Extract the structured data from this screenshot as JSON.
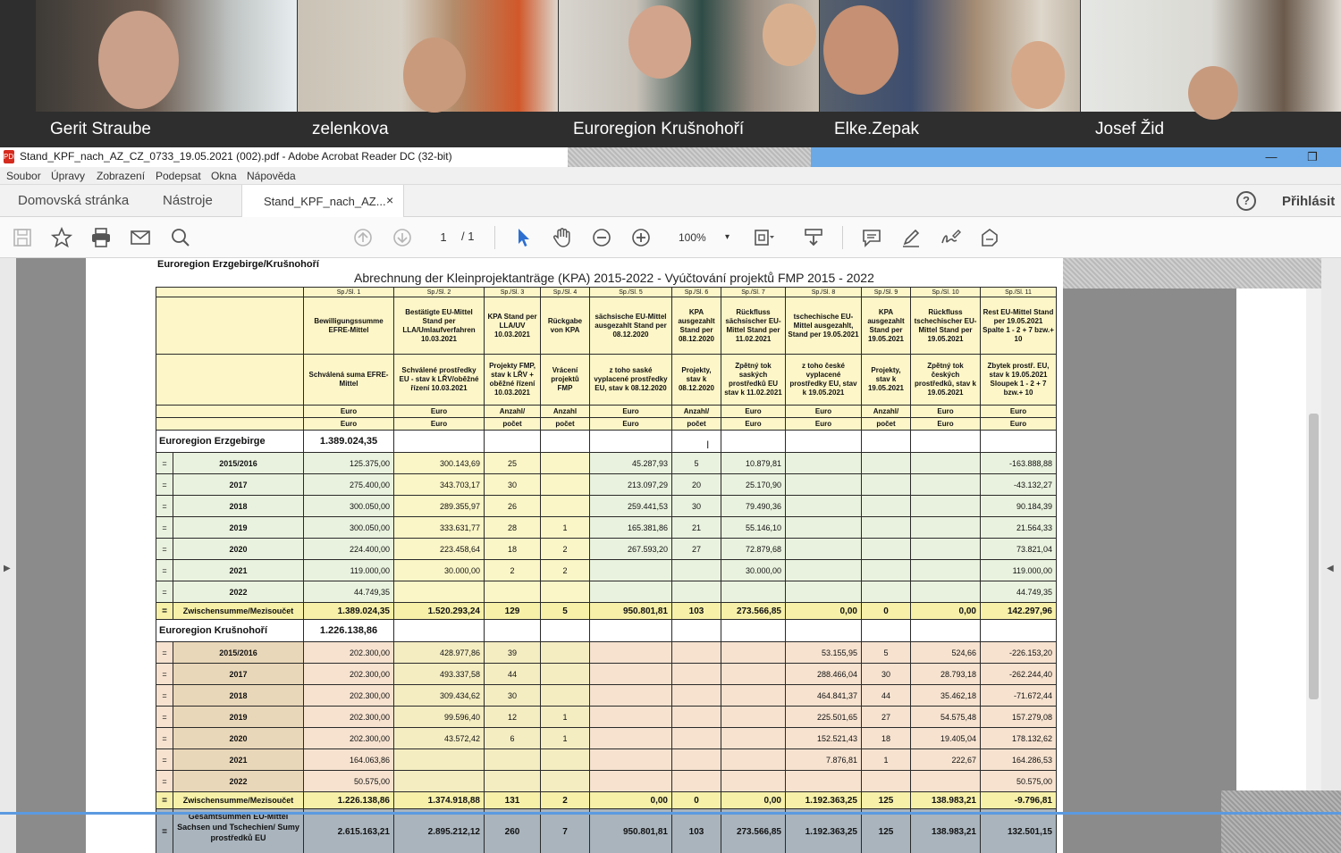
{
  "participants": [
    {
      "name": "Gerit Straube"
    },
    {
      "name": "zelenkova"
    },
    {
      "name": "Euroregion Krušnohoří"
    },
    {
      "name": "Elke.Zepak"
    },
    {
      "name": "Josef Žid"
    }
  ],
  "window": {
    "title": "Stand_KPF_nach_AZ_CZ_0733_19.05.2021 (002).pdf - Adobe Acrobat Reader DC (32-bit)",
    "pdf_icon": "PDF",
    "minimize": "—",
    "restore": "❐"
  },
  "menu": [
    "Soubor",
    "Úpravy",
    "Zobrazení",
    "Podepsat",
    "Okna",
    "Nápověda"
  ],
  "tabs": {
    "home": "Domovská stránka",
    "tools": "Nástroje",
    "document": "Stand_KPF_nach_AZ...",
    "close": "×",
    "help": "?",
    "signin": "Přihlásit"
  },
  "toolbar": {
    "page_current": "1",
    "page_total": "/ 1",
    "zoom": "100%",
    "zoom_caret": "▾",
    "icons": [
      "save-icon",
      "star-icon",
      "print-icon",
      "mail-icon",
      "search-icon",
      "page-up-icon",
      "page-down-icon",
      "select-cursor-icon",
      "hand-icon",
      "zoom-out-icon",
      "zoom-in-icon",
      "fit-page-icon",
      "scroll-icon",
      "comment-icon",
      "highlight-pen-icon",
      "sign-icon",
      "more-tools-icon"
    ]
  },
  "panels": {
    "left_arrow": "▶",
    "right_arrow": "◀"
  },
  "document": {
    "org_title": "Euroregion Erzgebirge/Krušnohoří",
    "title": "Abrechnung der Kleinprojektanträge (KPA) 2015-2022 - Vyúčtování projektů FMP 2015 - 2022",
    "sp_row": [
      "Sp./Sl. 1",
      "Sp./Sl. 2",
      "Sp./Sl. 3",
      "Sp./Sl. 4",
      "Sp./Sl. 5",
      "Sp./Sl. 6",
      "Sp./Sl. 7",
      "Sp./Sl. 8",
      "Sp./Sl. 9",
      "Sp./Sl. 10",
      "Sp./Sl. 11"
    ],
    "header_de": [
      "Bewilligungssumme EFRE-Mittel",
      "Bestätigte EU-Mittel Stand per LLA/Umlaufverfahren 10.03.2021",
      "KPA Stand per LLA/UV 10.03.2021",
      "Rückgabe von KPA",
      "sächsische EU-Mittel ausgezahlt Stand per 08.12.2020",
      "KPA ausgezahlt Stand per 08.12.2020",
      "Rückfluss sächsischer EU-Mittel Stand per 11.02.2021",
      "tschechische EU-Mittel ausgezahlt, Stand per 19.05.2021",
      "KPA ausgezahlt Stand per 19.05.2021",
      "Rückfluss tschechischer EU-Mittel Stand per 19.05.2021",
      "Rest EU-Mittel Stand per 19.05.2021 Spalte 1 - 2 + 7 bzw.+ 10"
    ],
    "header_cz": [
      "Schválená suma EFRE-Mittel",
      "Schválené prostředky EU - stav k LŘV/oběžné řízení 10.03.2021",
      "Projekty FMP, stav k LŘV + oběžné řízení 10.03.2021",
      "Vrácení projektů FMP",
      "z toho saské vyplacené prostředky EU, stav k 08.12.2020",
      "Projekty, stav k 08.12.2020",
      "Zpětný tok saských prostředků EU stav k 11.02.2021",
      "z toho české vyplacené prostředky EU, stav k 19.05.2021",
      "Projekty, stav k 19.05.2021",
      "Zpětný tok českých prostředků, stav k 19.05.2021",
      "Zbytek prostř. EU, stav k 19.05.2021 Sloupek 1 - 2 + 7 bzw.+ 10"
    ],
    "unit_de": [
      "Euro",
      "Euro",
      "Anzahl/",
      "Anzahl",
      "Euro",
      "Anzahl/",
      "Euro",
      "Euro",
      "Anzahl/",
      "Euro",
      "Euro"
    ],
    "unit_cz": [
      "Euro",
      "Euro",
      "počet",
      "počet",
      "Euro",
      "počet",
      "Euro",
      "Euro",
      "počet",
      "Euro",
      "Euro"
    ],
    "row_marker": "=",
    "groups": [
      {
        "name": "Euroregion Erzgebirge",
        "sum": "1.389.024,35",
        "rows": [
          [
            "2015/2016",
            "125.375,00",
            "300.143,69",
            "25",
            "",
            "45.287,93",
            "5",
            "10.879,81",
            "",
            "",
            "",
            "-163.888,88"
          ],
          [
            "2017",
            "275.400,00",
            "343.703,17",
            "30",
            "",
            "213.097,29",
            "20",
            "25.170,90",
            "",
            "",
            "",
            "-43.132,27"
          ],
          [
            "2018",
            "300.050,00",
            "289.355,97",
            "26",
            "",
            "259.441,53",
            "30",
            "79.490,36",
            "",
            "",
            "",
            "90.184,39"
          ],
          [
            "2019",
            "300.050,00",
            "333.631,77",
            "28",
            "1",
            "165.381,86",
            "21",
            "55.146,10",
            "",
            "",
            "",
            "21.564,33"
          ],
          [
            "2020",
            "224.400,00",
            "223.458,64",
            "18",
            "2",
            "267.593,20",
            "27",
            "72.879,68",
            "",
            "",
            "",
            "73.821,04"
          ],
          [
            "2021",
            "119.000,00",
            "30.000,00",
            "2",
            "2",
            "",
            "",
            "30.000,00",
            "",
            "",
            "",
            "119.000,00"
          ],
          [
            "2022",
            "44.749,35",
            "",
            "",
            "",
            "",
            "",
            "",
            "",
            "",
            "",
            "44.749,35"
          ]
        ],
        "subtotal": [
          "Zwischensumme/Mezisoučet",
          "1.389.024,35",
          "1.520.293,24",
          "129",
          "5",
          "950.801,81",
          "103",
          "273.566,85",
          "0,00",
          "0",
          "0,00",
          "142.297,96"
        ]
      },
      {
        "name": "Euroregion Krušnohoří",
        "sum": "1.226.138,86",
        "rows": [
          [
            "2015/2016",
            "202.300,00",
            "428.977,86",
            "39",
            "",
            "",
            "",
            "",
            "53.155,95",
            "5",
            "524,66",
            "-226.153,20"
          ],
          [
            "2017",
            "202.300,00",
            "493.337,58",
            "44",
            "",
            "",
            "",
            "",
            "288.466,04",
            "30",
            "28.793,18",
            "-262.244,40"
          ],
          [
            "2018",
            "202.300,00",
            "309.434,62",
            "30",
            "",
            "",
            "",
            "",
            "464.841,37",
            "44",
            "35.462,18",
            "-71.672,44"
          ],
          [
            "2019",
            "202.300,00",
            "99.596,40",
            "12",
            "1",
            "",
            "",
            "",
            "225.501,65",
            "27",
            "54.575,48",
            "157.279,08"
          ],
          [
            "2020",
            "202.300,00",
            "43.572,42",
            "6",
            "1",
            "",
            "",
            "",
            "152.521,43",
            "18",
            "19.405,04",
            "178.132,62"
          ],
          [
            "2021",
            "164.063,86",
            "",
            "",
            "",
            "",
            "",
            "",
            "7.876,81",
            "1",
            "222,67",
            "164.286,53"
          ],
          [
            "2022",
            "50.575,00",
            "",
            "",
            "",
            "",
            "",
            "",
            "",
            "",
            "",
            "50.575,00"
          ]
        ],
        "subtotal": [
          "Zwischensumme/Mezisoučet",
          "1.226.138,86",
          "1.374.918,88",
          "131",
          "2",
          "0,00",
          "0",
          "0,00",
          "1.192.363,25",
          "125",
          "138.983,21",
          "-9.796,81"
        ]
      }
    ],
    "total": [
      "Gesamtsummen EU-Mittel Sachsen und Tschechien/ Sumy prostředků EU",
      "2.615.163,21",
      "2.895.212,12",
      "260",
      "7",
      "950.801,81",
      "103",
      "273.566,85",
      "1.192.363,25",
      "125",
      "138.983,21",
      "132.501,15"
    ]
  }
}
